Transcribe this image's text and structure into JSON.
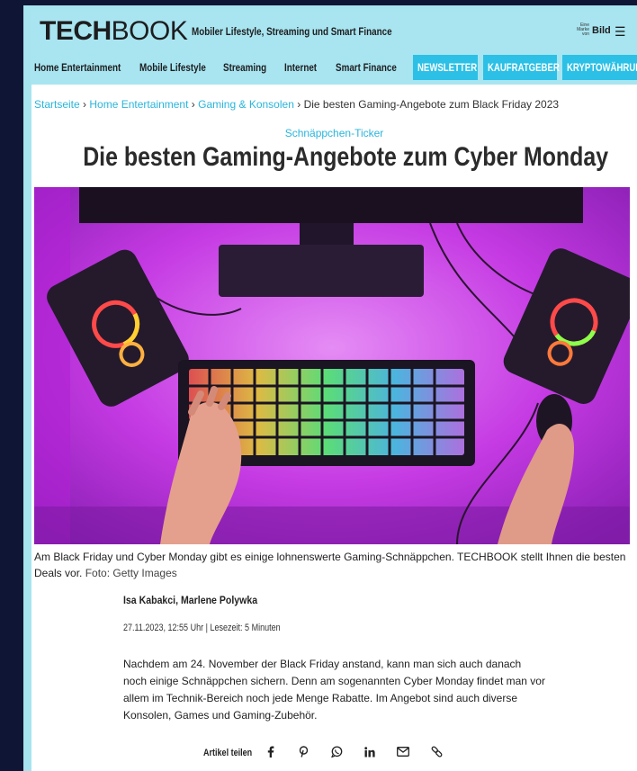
{
  "header": {
    "logo_bold": "TECH",
    "logo_light": "BOOK",
    "tagline": "Mobiler Lifestyle, Streaming und Smart Finance",
    "brand_small": "Eine Marke von",
    "brand_name": "Bild",
    "menu_icon": "hamburger-menu-icon"
  },
  "nav": {
    "items": [
      "Home Entertainment",
      "Mobile Lifestyle",
      "Streaming",
      "Internet",
      "Smart Finance"
    ],
    "buttons": [
      "NEWSLETTER",
      "KAUFRATGEBER",
      "KRYPTOWÄHRUNG"
    ]
  },
  "breadcrumb": {
    "items": [
      "Startseite",
      "Home Entertainment",
      "Gaming & Konsolen",
      "Die besten Gaming-Angebote zum Black Friday 2023"
    ],
    "separator": "›"
  },
  "article": {
    "kicker": "Schnäppchen-Ticker",
    "headline": "Die besten Gaming-Angebote zum Cyber Monday",
    "caption": "Am Black Friday und Cyber Monday gibt es einige lohnenswerte Gaming-Schnäppchen. TECHBOOK stellt Ihnen die besten Deals vor.",
    "credit": "Foto: Getty Images",
    "authors": "Isa Kabakci, Marlene Polywka",
    "meta": "27.11.2023, 12:55 Uhr | Lesezeit: 5 Minuten",
    "lead": "Nachdem am 24. November der Black Friday anstand, kann man sich auch danach noch einige Schnäppchen sichern. Denn am sogenannten Cyber Monday findet man vor allem im Technik-Bereich noch jede Menge Rabatte. Im Angebot sind auch diverse Konsolen, Games und Gaming-Zubehör."
  },
  "share": {
    "label": "Artikel teilen",
    "icons": [
      "facebook-icon",
      "pinterest-icon",
      "whatsapp-icon",
      "linkedin-icon",
      "email-icon",
      "link-icon"
    ]
  },
  "colors": {
    "header_bg": "#a8e5f0",
    "accent": "#2cc0e6",
    "link": "#2ab5dc",
    "hero_magenta": "#c02be0"
  }
}
